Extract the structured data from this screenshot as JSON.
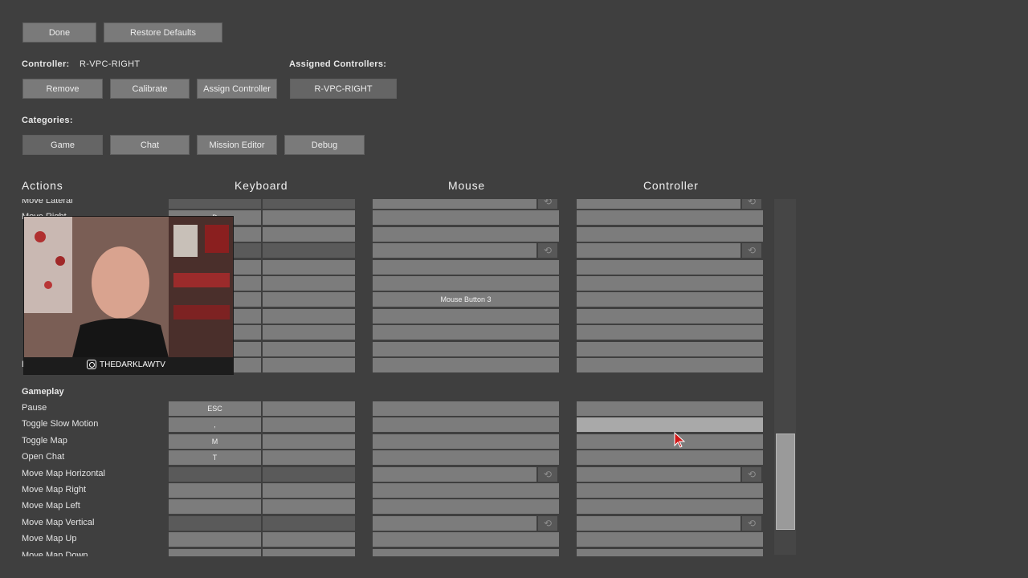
{
  "top_buttons": {
    "done": "Done",
    "restore": "Restore Defaults"
  },
  "controller": {
    "label": "Controller:",
    "name": "R-VPC-RIGHT",
    "assigned_label": "Assigned Controllers:",
    "remove": "Remove",
    "calibrate": "Calibrate",
    "assign": "Assign Controller",
    "assigned_item": "R-VPC-RIGHT"
  },
  "categories": {
    "label": "Categories:",
    "items": [
      "Game",
      "Chat",
      "Mission Editor",
      "Debug"
    ]
  },
  "columns": {
    "actions": "Actions",
    "keyboard": "Keyboard",
    "mouse": "Mouse",
    "controller": "Controller"
  },
  "top_rows": [
    {
      "name": "Move Lateral",
      "kb1": "",
      "kb2": "",
      "mouse": "",
      "ctrl": "",
      "axis": true
    },
    {
      "name": "Move Right",
      "kb1": "D",
      "kb2": "",
      "mouse": "",
      "ctrl": "",
      "axis": false
    },
    {
      "name": "",
      "kb1": "",
      "kb2": "",
      "mouse": "",
      "ctrl": "",
      "axis": false
    },
    {
      "name": "",
      "kb1": "",
      "kb2": "",
      "mouse": "",
      "ctrl": "",
      "axis": true
    },
    {
      "name": "",
      "kb1": "",
      "kb2": "",
      "mouse": "",
      "ctrl": "",
      "axis": false
    },
    {
      "name": "",
      "kb1": "",
      "kb2": "",
      "mouse": "",
      "ctrl": "",
      "axis": false
    },
    {
      "name": "",
      "kb1": "",
      "kb2": "",
      "mouse": "Mouse Button 3",
      "ctrl": "",
      "axis": false
    },
    {
      "name": "",
      "kb1": "",
      "kb2": "",
      "mouse": "",
      "ctrl": "",
      "axis": false
    },
    {
      "name": "",
      "kb1": "",
      "kb2": "",
      "mouse": "",
      "ctrl": "",
      "axis": false
    },
    {
      "name": "",
      "kb1": "",
      "kb2": "",
      "mouse": "",
      "ctrl": "",
      "axis": false
    },
    {
      "name": "Look At",
      "kb1": "",
      "kb2": "",
      "mouse": "",
      "ctrl": "",
      "axis": false
    }
  ],
  "gameplay": {
    "title": "Gameplay",
    "rows": [
      {
        "name": "Pause",
        "kb1": "ESC",
        "kb2": "",
        "mouse": "",
        "ctrl": "",
        "axis": false
      },
      {
        "name": "Toggle Slow Motion",
        "kb1": ",",
        "kb2": "",
        "mouse": "",
        "ctrl": "",
        "axis": false,
        "highlight": true
      },
      {
        "name": "Toggle Map",
        "kb1": "M",
        "kb2": "",
        "mouse": "",
        "ctrl": "",
        "axis": false
      },
      {
        "name": "Open Chat",
        "kb1": "T",
        "kb2": "",
        "mouse": "",
        "ctrl": "",
        "axis": false
      },
      {
        "name": "Move Map Horizontal",
        "kb1": "",
        "kb2": "",
        "mouse": "",
        "ctrl": "",
        "axis": true
      },
      {
        "name": "Move Map Right",
        "kb1": "",
        "kb2": "",
        "mouse": "",
        "ctrl": "",
        "axis": false
      },
      {
        "name": "Move Map Left",
        "kb1": "",
        "kb2": "",
        "mouse": "",
        "ctrl": "",
        "axis": false
      },
      {
        "name": "Move Map Vertical",
        "kb1": "",
        "kb2": "",
        "mouse": "",
        "ctrl": "",
        "axis": true
      },
      {
        "name": "Move Map Up",
        "kb1": "",
        "kb2": "",
        "mouse": "",
        "ctrl": "",
        "axis": false
      },
      {
        "name": "Move Map Down",
        "kb1": "",
        "kb2": "",
        "mouse": "",
        "ctrl": "",
        "axis": false
      }
    ]
  },
  "webcam": {
    "handle": "THEDARKLAWTV"
  },
  "icons": {
    "reset": "reset-arrows-icon",
    "cursor": "mouse-pointer-icon",
    "social": "instagram-icon"
  },
  "colors": {
    "background": "#3f3f3f",
    "button": "#7a7a7a",
    "highlight": "#a9a9a9",
    "cursor": "#d01818"
  }
}
